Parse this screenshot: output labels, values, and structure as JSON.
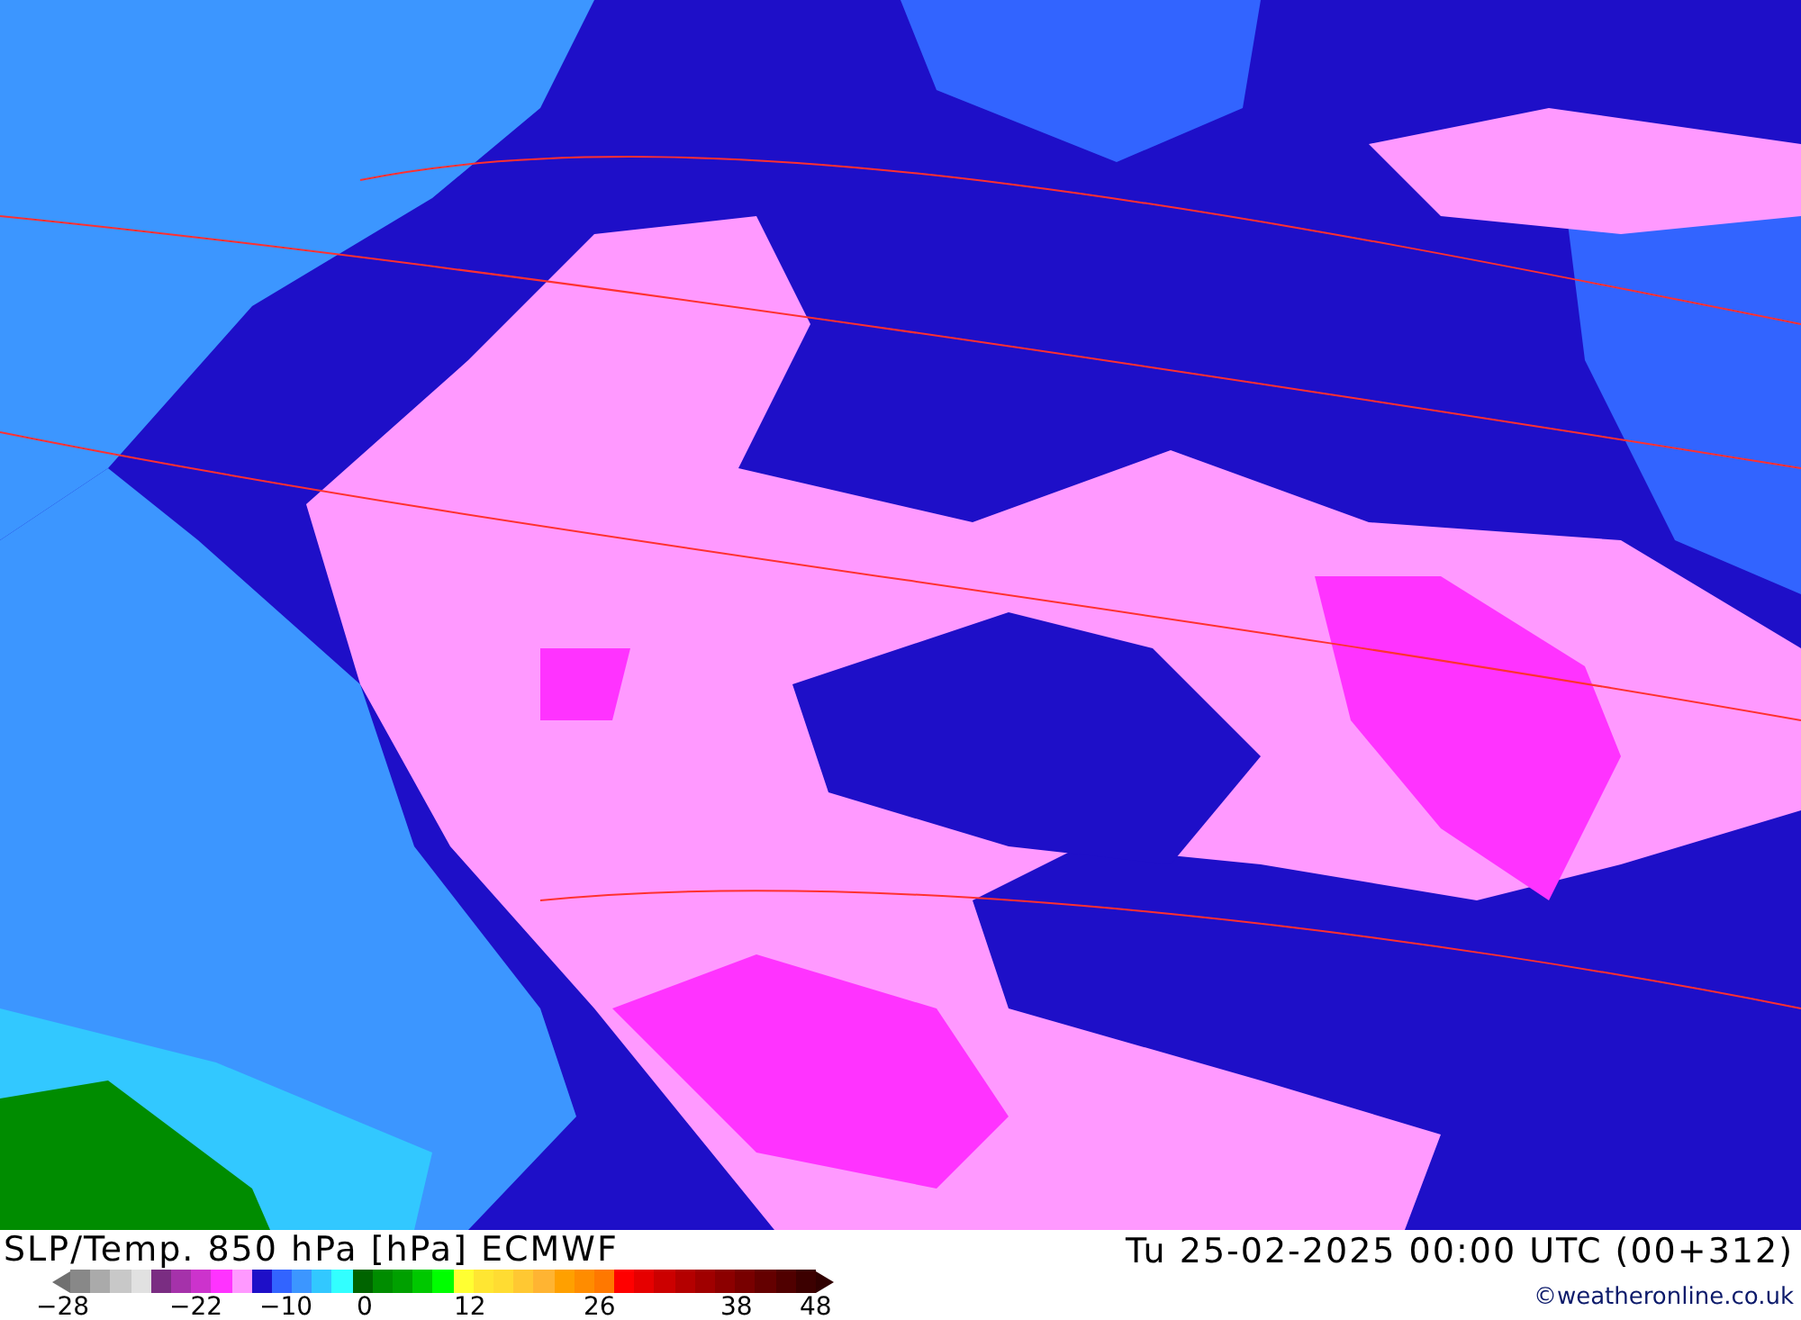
{
  "title": "SLP/Temp. 850 hPa [hPa] ECMWF",
  "valid_time": "Tu 25-02-2025 00:00 UTC (00+312)",
  "legend": {
    "swatches": [
      {
        "color": "#888888"
      },
      {
        "color": "#aaaaaa"
      },
      {
        "color": "#c8c8c8"
      },
      {
        "color": "#e1e1e1"
      },
      {
        "color": "#7a2d82"
      },
      {
        "color": "#a532aa"
      },
      {
        "color": "#cc33cc"
      },
      {
        "color": "#ff33ff"
      },
      {
        "color": "#ff99ff"
      },
      {
        "color": "#1e0fc8"
      },
      {
        "color": "#3264ff"
      },
      {
        "color": "#3c96ff"
      },
      {
        "color": "#32c8ff"
      },
      {
        "color": "#32ffff"
      },
      {
        "color": "#006400"
      },
      {
        "color": "#008c00"
      },
      {
        "color": "#00a000"
      },
      {
        "color": "#00c800"
      },
      {
        "color": "#00ff00"
      },
      {
        "color": "#ffff32"
      },
      {
        "color": "#ffe632"
      },
      {
        "color": "#ffdc32"
      },
      {
        "color": "#ffc832"
      },
      {
        "color": "#ffb432"
      },
      {
        "color": "#ffa000"
      },
      {
        "color": "#ff8c00"
      },
      {
        "color": "#ff7800"
      },
      {
        "color": "#ff0000"
      },
      {
        "color": "#e60000"
      },
      {
        "color": "#cc0000"
      },
      {
        "color": "#b40000"
      },
      {
        "color": "#a00000"
      },
      {
        "color": "#8c0000"
      },
      {
        "color": "#780000"
      },
      {
        "color": "#640000"
      },
      {
        "color": "#500000"
      },
      {
        "color": "#3c0000"
      }
    ],
    "ticks": [
      "−28",
      "−22",
      "−10",
      "0",
      "12",
      "26",
      "38",
      "48"
    ]
  },
  "credit": "©weatheronline.co.uk"
}
